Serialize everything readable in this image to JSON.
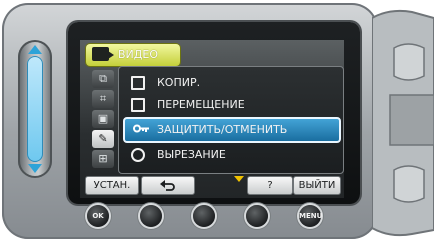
{
  "screen": {
    "tab": {
      "label": "ВИДЕО",
      "icon": "video-camera-icon"
    },
    "side_icons": [
      "copy-icon",
      "group-icon",
      "playback-icon",
      "tools-icon",
      "grid-icon"
    ],
    "menu_items": [
      {
        "label": "КОПИР.",
        "icon": "copy-square-icon",
        "selected": false
      },
      {
        "label": "ПЕРЕМЕЩЕНИЕ",
        "icon": "move-icon",
        "selected": false
      },
      {
        "label": "ЗАЩИТИТЬ/ОТМЕНИТЬ",
        "icon": "key-icon",
        "selected": true
      },
      {
        "label": "ВЫРЕЗАНИЕ",
        "icon": "scissors-icon",
        "selected": false
      }
    ],
    "softkeys": {
      "set": "УСТАН.",
      "back_icon": "return-arrow-icon",
      "help": "?",
      "exit": "ВЫЙТИ"
    }
  },
  "hardware_buttons": {
    "ok": "OK",
    "menu": "MENU"
  },
  "colors": {
    "tab": "#d8e24a",
    "selection": "#2a86c2",
    "rail": "#6ec8ef",
    "scroll_arrow": "#f1c200"
  }
}
